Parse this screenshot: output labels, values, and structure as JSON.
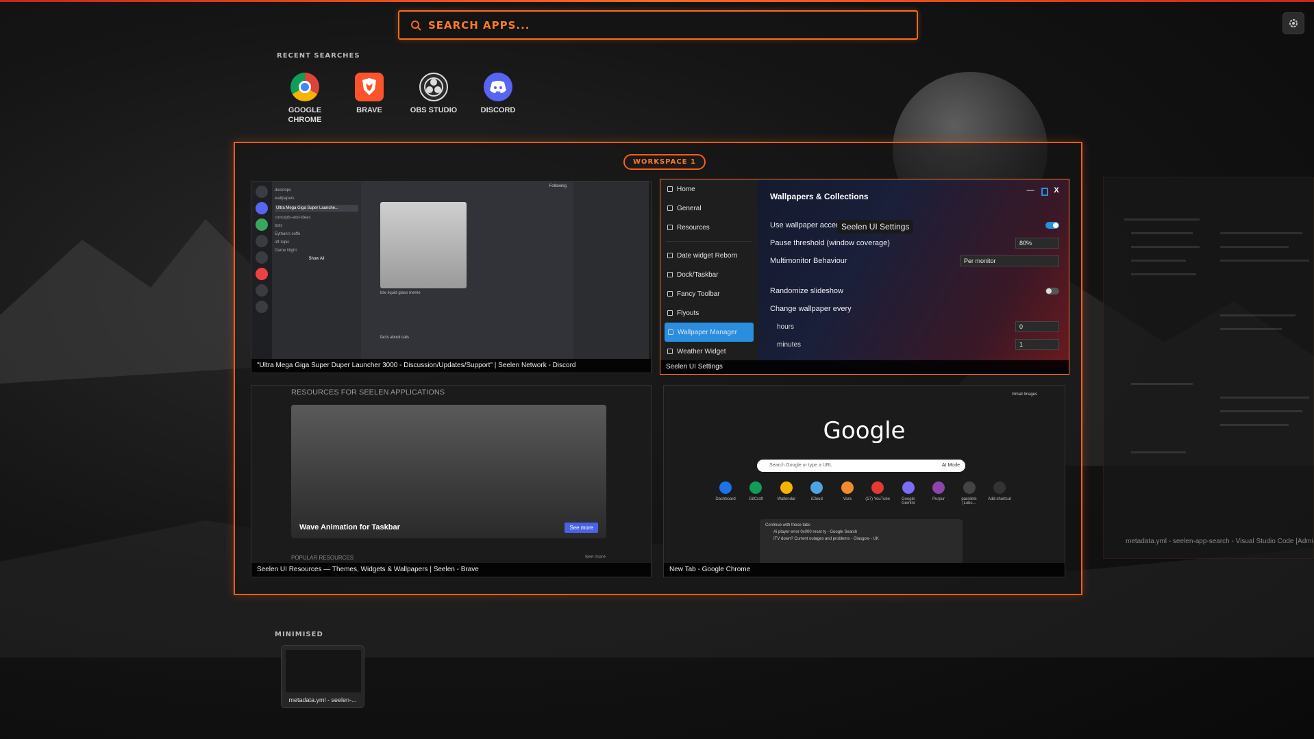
{
  "search": {
    "placeholder": "SEARCH APPS..."
  },
  "recent": {
    "label": "RECENT SEARCHES",
    "apps": [
      {
        "name": "GOOGLE CHROME",
        "icon": "chrome-icon"
      },
      {
        "name": "BRAVE",
        "icon": "brave-icon"
      },
      {
        "name": "OBS STUDIO",
        "icon": "obs-icon"
      },
      {
        "name": "DISCORD",
        "icon": "discord-icon"
      }
    ]
  },
  "workspace": {
    "label": "WORKSPACE 1",
    "windows": {
      "discord": {
        "title": "\"Ultra Mega Giga Super Duper Launcher 3000 - Discussion/Updates/Support\" | Seelen Network - Discord",
        "channels": [
          "desktops",
          "wallpapers",
          "Ultra Mega Giga Super Launche...",
          "concepts-and-ideas",
          "bots",
          "Eythan's coffe",
          "off-topic",
          "Game Night"
        ],
        "show_all": "Show All",
        "following": "Following",
        "caption_text": "blw liquid glass meme",
        "chat_text": "facts about cats"
      },
      "settings": {
        "title": "Seelen UI Settings",
        "tooltip": "Seelen UI Settings",
        "nav": [
          "Home",
          "General",
          "Resources",
          "Date widget Reborn",
          "Dock/Taskbar",
          "Fancy Toolbar",
          "Flyouts",
          "Wallpaper Manager",
          "Weather Widget"
        ],
        "active_nav": "Wallpaper Manager",
        "heading": "Wallpapers & Collections",
        "options": {
          "accent": "Use wallpaper accent col",
          "pause": "Pause threshold (window coverage)",
          "pause_value": "80%",
          "monitor": "Multimonitor Behaviour",
          "monitor_value": "Per monitor",
          "randomize": "Randomize slideshow",
          "change": "Change wallpaper every",
          "hours_label": "hours",
          "hours_value": "0",
          "minutes_label": "minutes",
          "minutes_value": "1"
        },
        "close": "X",
        "minimize": "—"
      },
      "brave": {
        "title": "Seelen UI Resources — Themes, Widgets & Wallpapers | Seelen - Brave",
        "heading": "RESOURCES FOR SEELEN APPLICATIONS",
        "card_title": "Wave Animation for Taskbar",
        "card_button": "See more",
        "popular": "POPULAR RESOURCES",
        "see_more": "See more"
      },
      "chrome": {
        "title": "New Tab - Google Chrome",
        "logo": "Google",
        "search_placeholder": "Search Google or type a URL",
        "ai_mode": "AI Mode",
        "top_links": "Gmail  Images",
        "shortcuts": [
          "Dashboard",
          "GitCraft",
          "Wallendar",
          "iCloud",
          "Vara",
          "(17) YouTube",
          "Google Gemini",
          "Purpur",
          "parallels (Lobs...",
          "Add shortcut"
        ],
        "tabs_heading": "Continue with these tabs",
        "tab1": "Ai player error 0x000 reset ty - Google Search",
        "tab2": "ITV down? Current outages and problems - Glasgow - UK"
      }
    }
  },
  "side_window": {
    "title": "metadata.yml - seelen-app-search - Visual Studio Code [Adminis"
  },
  "minimised": {
    "label": "MINIMISED",
    "items": [
      {
        "name": "metadata.yml - seelen-..."
      }
    ]
  },
  "colors": {
    "accent": "#ff5e14",
    "blue": "#2a8de0"
  }
}
